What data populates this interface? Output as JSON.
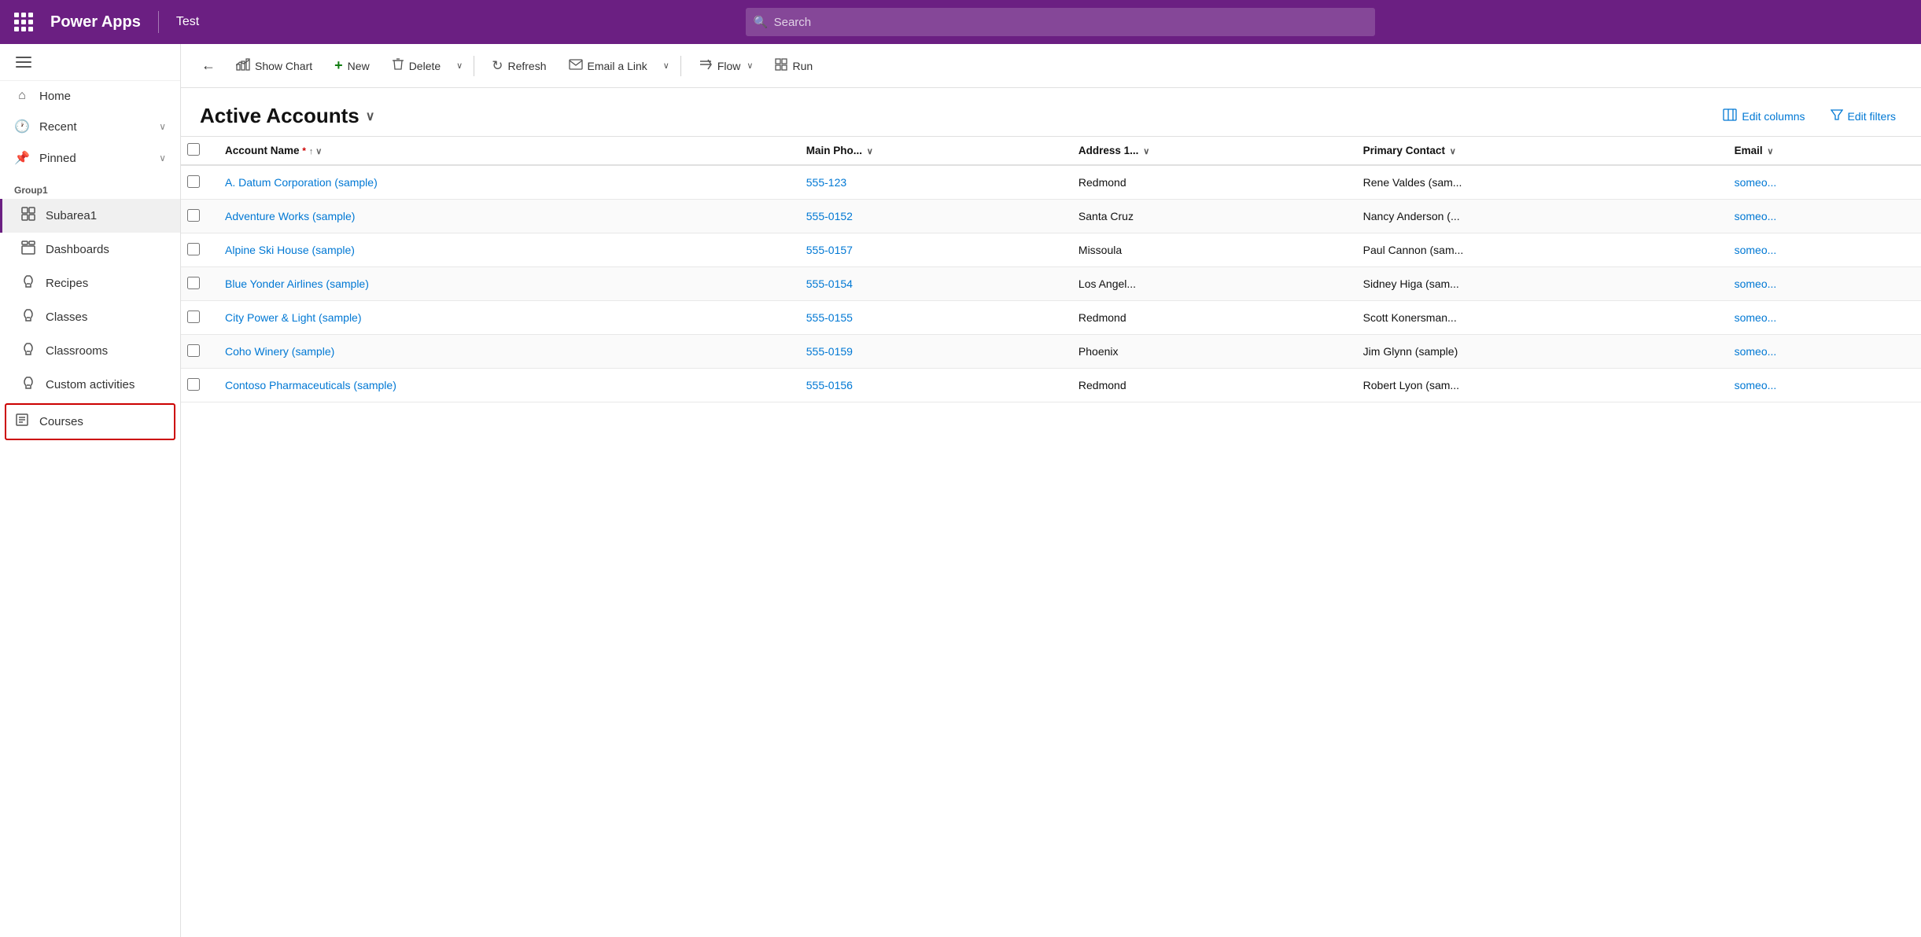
{
  "topbar": {
    "app_name": "Power Apps",
    "divider": true,
    "env_name": "Test",
    "search_placeholder": "Search"
  },
  "sidebar": {
    "nav_items": [
      {
        "id": "home",
        "label": "Home",
        "icon": "home",
        "has_chevron": false,
        "active": false,
        "sub": false
      },
      {
        "id": "recent",
        "label": "Recent",
        "icon": "recent",
        "has_chevron": true,
        "active": false,
        "sub": false
      },
      {
        "id": "pinned",
        "label": "Pinned",
        "icon": "pinned",
        "has_chevron": true,
        "active": false,
        "sub": false
      }
    ],
    "group_label": "Group1",
    "group_items": [
      {
        "id": "subarea1",
        "label": "Subarea1",
        "icon": "subarea",
        "active": true,
        "sub": true
      },
      {
        "id": "dashboards",
        "label": "Dashboards",
        "icon": "dashboard",
        "active": false,
        "sub": true
      },
      {
        "id": "recipes",
        "label": "Recipes",
        "icon": "puzzle",
        "active": false,
        "sub": true
      },
      {
        "id": "classes",
        "label": "Classes",
        "icon": "puzzle",
        "active": false,
        "sub": true
      },
      {
        "id": "classrooms",
        "label": "Classrooms",
        "icon": "puzzle",
        "active": false,
        "sub": true
      },
      {
        "id": "custom-activities",
        "label": "Custom activities",
        "icon": "puzzle",
        "active": false,
        "sub": true
      },
      {
        "id": "courses",
        "label": "Courses",
        "icon": "courses",
        "active": false,
        "sub": true
      }
    ]
  },
  "toolbar": {
    "back_label": "←",
    "show_chart_label": "Show Chart",
    "new_label": "New",
    "delete_label": "Delete",
    "refresh_label": "Refresh",
    "email_link_label": "Email a Link",
    "flow_label": "Flow",
    "run_label": "Run"
  },
  "view": {
    "title": "Active Accounts",
    "edit_columns_label": "Edit columns",
    "edit_filters_label": "Edit filters"
  },
  "table": {
    "columns": [
      {
        "id": "account_name",
        "label": "Account Name",
        "required": true,
        "sortable": true,
        "has_chevron": true
      },
      {
        "id": "main_phone",
        "label": "Main Pho...",
        "sortable": false,
        "has_chevron": true
      },
      {
        "id": "address1",
        "label": "Address 1...",
        "sortable": false,
        "has_chevron": true
      },
      {
        "id": "primary_contact",
        "label": "Primary Contact",
        "sortable": false,
        "has_chevron": true
      },
      {
        "id": "email",
        "label": "Email",
        "sortable": false,
        "has_chevron": true
      }
    ],
    "rows": [
      {
        "id": "row1",
        "account_name": "A. Datum Corporation (sample)",
        "main_phone": "555-123",
        "address1": "Redmond",
        "primary_contact": "Rene Valdes (sam...",
        "email": "someo..."
      },
      {
        "id": "row2",
        "account_name": "Adventure Works (sample)",
        "main_phone": "555-0152",
        "address1": "Santa Cruz",
        "primary_contact": "Nancy Anderson (...",
        "email": "someo..."
      },
      {
        "id": "row3",
        "account_name": "Alpine Ski House (sample)",
        "main_phone": "555-0157",
        "address1": "Missoula",
        "primary_contact": "Paul Cannon (sam...",
        "email": "someo..."
      },
      {
        "id": "row4",
        "account_name": "Blue Yonder Airlines (sample)",
        "main_phone": "555-0154",
        "address1": "Los Angel...",
        "primary_contact": "Sidney Higa (sam...",
        "email": "someo..."
      },
      {
        "id": "row5",
        "account_name": "City Power & Light (sample)",
        "main_phone": "555-0155",
        "address1": "Redmond",
        "primary_contact": "Scott Konersman...",
        "email": "someo..."
      },
      {
        "id": "row6",
        "account_name": "Coho Winery (sample)",
        "main_phone": "555-0159",
        "address1": "Phoenix",
        "primary_contact": "Jim Glynn (sample)",
        "email": "someo..."
      },
      {
        "id": "row7",
        "account_name": "Contoso Pharmaceuticals (sample)",
        "main_phone": "555-0156",
        "address1": "Redmond",
        "primary_contact": "Robert Lyon (sam...",
        "email": "someo..."
      }
    ]
  },
  "colors": {
    "topbar_bg": "#6b1f82",
    "accent_blue": "#0078d4",
    "active_nav_border": "#6b1f82",
    "link_color": "#0078d4"
  }
}
